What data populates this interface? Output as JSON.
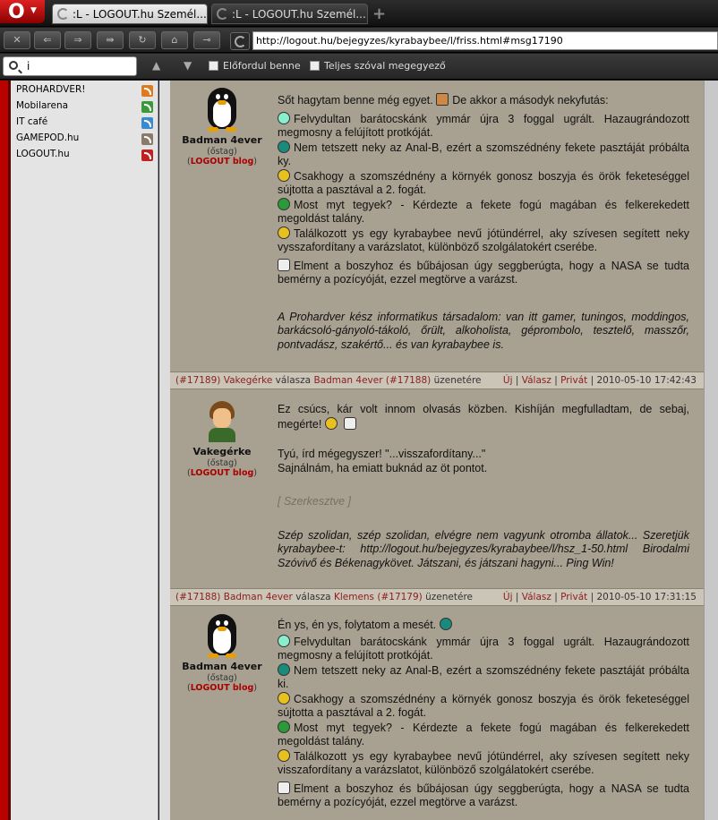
{
  "browser": {
    "tabs": [
      {
        "title": ":L - LOGOUT.hu Személ..."
      },
      {
        "title": ":L - LOGOUT.hu Személ..."
      }
    ],
    "address": "http://logout.hu/bejegyzes/kyrabaybee/l/friss.html#msg17190",
    "find": {
      "query": "i",
      "opt1": "Előfordul benne",
      "opt2": "Teljes szóval megegyező"
    }
  },
  "sidebar": {
    "items": [
      {
        "label": "PROHARDVER!",
        "color": "#e07a20"
      },
      {
        "label": "Mobilarena",
        "color": "#3a9a3a"
      },
      {
        "label": "IT café",
        "color": "#3a8ad0"
      },
      {
        "label": "GAMEPOD.hu",
        "color": "#8a7a6a"
      },
      {
        "label": "LOGOUT.hu",
        "color": "#c02020"
      }
    ]
  },
  "posts": [
    {
      "author": "Badman 4ever",
      "rank": "(őstag)",
      "blog": "LOGOUT blog",
      "lines": [
        "Sőt hagytam benne még egyet.",
        "De akkor a másodyk nekyfutás:",
        "Felvydultan barátocskánk ymmár újra 3 foggal ugrált. Hazaugrándozott megmosny a felújított protkóját.",
        "Nem tetszett neky az Anal-B, ezért a szomszédnény fekete pasztáját próbálta ky.",
        "Csakhogy a szomszédnény a környék gonosz boszyja és örök feketeséggel sújtotta a pasztával a 2. fogát.",
        "Most myt tegyek? - Kérdezte a fekete fogú magában és felkerekedett megoldást talány.",
        "Találkozott ys egy kyrabaybee nevű jótündérrel, aky szívesen segített neky vysszafordítany a varázslatot, különböző szolgálatokért cserébe.",
        "Elment a boszyhoz és bűbájosan úgy seggberúgta, hogy a NASA se tudta bemérny a pozícyóját, ezzel megtörve a varázst."
      ],
      "signature": "A Prohardver kész informatikus társadalom: van itt gamer, tuningos, moddingos, barkácsoló-gányoló-tákoló, őrült, alkoholista, géprombolo, tesztelő, masszőr, pontvadász, szakértő... és van kyrabaybee is."
    },
    {
      "header": {
        "id": "(#17189)",
        "user": "Vakegérke",
        "verb": "válasza",
        "target": "Badman 4ever",
        "target_id": "(#17188)",
        "suffix": "üzenetére",
        "new": "Új",
        "reply": "Válasz",
        "private": "Privát",
        "date": "2010-05-10 17:42:43"
      },
      "author": "Vakegérke",
      "rank": "(őstag)",
      "blog": "LOGOUT blog",
      "lines": [
        "Ez csúcs, kár volt innom olvasás közben. Kishíján megfulladtam, de sebaj, megérte!",
        "Tyú, írd mégegyszer! \"...visszafordítany...\"",
        "Sajnálnám, ha emiatt buknád az öt pontot.",
        "[ Szerkesztve ]"
      ],
      "signature": "Szép szolidan, szép szolidan, elvégre nem vagyunk otromba állatok... Szeretjük kyrabaybee-t: http://logout.hu/bejegyzes/kyrabaybee/l/hsz_1-50.html Birodalmi Szóvivő és Békenagykövet. Játszani, és játszani hagyni... Ping Win!"
    },
    {
      "header": {
        "id": "(#17188)",
        "user": "Badman 4ever",
        "verb": "válasza",
        "target": "Klemens",
        "target_id": "(#17179)",
        "suffix": "üzenetére",
        "new": "Új",
        "reply": "Válasz",
        "private": "Privát",
        "date": "2010-05-10 17:31:15"
      },
      "author": "Badman 4ever",
      "rank": "(őstag)",
      "blog": "LOGOUT blog",
      "lines": [
        "Én ys, én ys, folytatom a mesét.",
        "Felvydultan barátocskánk ymmár újra 3 foggal ugrált. Hazaugrándozott megmosny a felújított protkóját.",
        "Nem tetszett neky az Anal-B, ezért a szomszédnény fekete pasztáját próbálta ki.",
        "Csakhogy a szomszédnény a környék gonosz boszyja és örök feketeséggel sújtotta a pasztával a 2. fogát.",
        "Most myt tegyek? - Kérdezte a fekete fogú magában és felkerekedett megoldást talány.",
        "Találkozott ys egy kyrabaybee nevű jótündérrel, aky szívesen segített neky visszafordítany a varázslatot, különböző szolgálatokért cserébe.",
        "Elment a boszyhoz és bűbájosan úgy seggberúgta, hogy a NASA se tudta bemérny a pozícyóját, ezzel megtörve a varázst."
      ]
    }
  ]
}
